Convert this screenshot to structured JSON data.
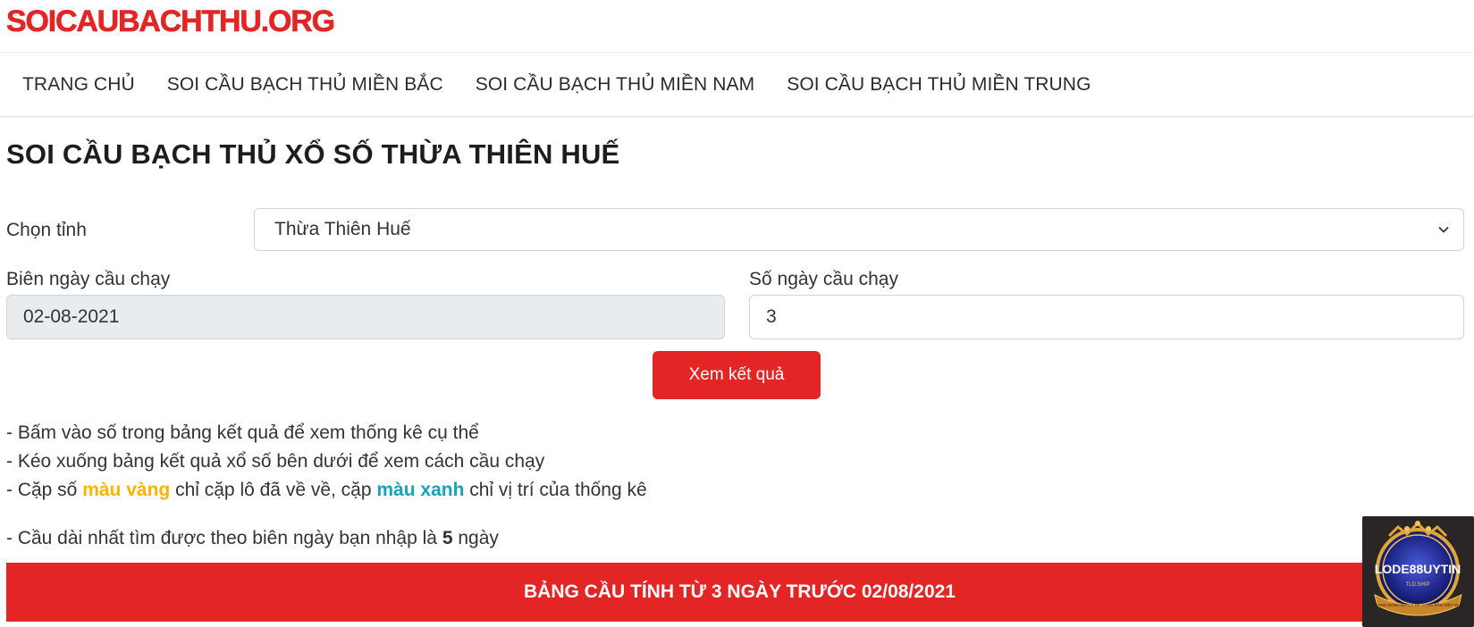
{
  "site": {
    "logo_text": "SOICAUBACHTHU.ORG",
    "brand_color": "#e42525"
  },
  "nav": {
    "items": [
      {
        "label": "TRANG CHỦ"
      },
      {
        "label": "SOI CẦU BẠCH THỦ MIỀN BẮC"
      },
      {
        "label": "SOI CẦU BẠCH THỦ MIỀN NAM"
      },
      {
        "label": "SOI CẦU BẠCH THỦ MIỀN TRUNG"
      }
    ]
  },
  "page": {
    "title": "SOI CẦU BẠCH THỦ XỔ SỐ THỪA THIÊN HUẾ"
  },
  "form": {
    "province_label": "Chọn tỉnh",
    "province_value": "Thừa Thiên Huế",
    "date_label": "Biên ngày cầu chạy",
    "date_value": "02-08-2021",
    "days_label": "Số ngày cầu chạy",
    "days_value": "3",
    "submit_label": "Xem kết quả"
  },
  "notes": {
    "line1": "- Bấm vào số trong bảng kết quả để xem thống kê cụ thể",
    "line2": "- Kéo xuống bảng kết quả xổ số bên dưới để xem cách cầu chạy",
    "line3_a": "- Cặp số ",
    "line3_yellow": "màu vàng",
    "line3_b": " chỉ cặp lô đã về về, cặp ",
    "line3_teal": "màu xanh",
    "line3_c": " chỉ vị trí của thống kê",
    "longest_a": "- Cầu dài nhất tìm được theo biên ngày bạn nhập là ",
    "longest_value": "5",
    "longest_b": " ngày",
    "colors": {
      "yellow": "#f7b500",
      "teal": "#17a2b8"
    }
  },
  "banner": {
    "text": "BẢNG CẦU TÍNH TỪ 3 NGÀY TRƯỚC 02/08/2021"
  },
  "ad": {
    "brand": "LODE88UYTIN",
    "sub": "TLD.SHIP",
    "tagline": "TRANG ĐÁNH GIÁ LÔ ĐỀ HÀNG ĐẦU VIỆT NAM"
  }
}
